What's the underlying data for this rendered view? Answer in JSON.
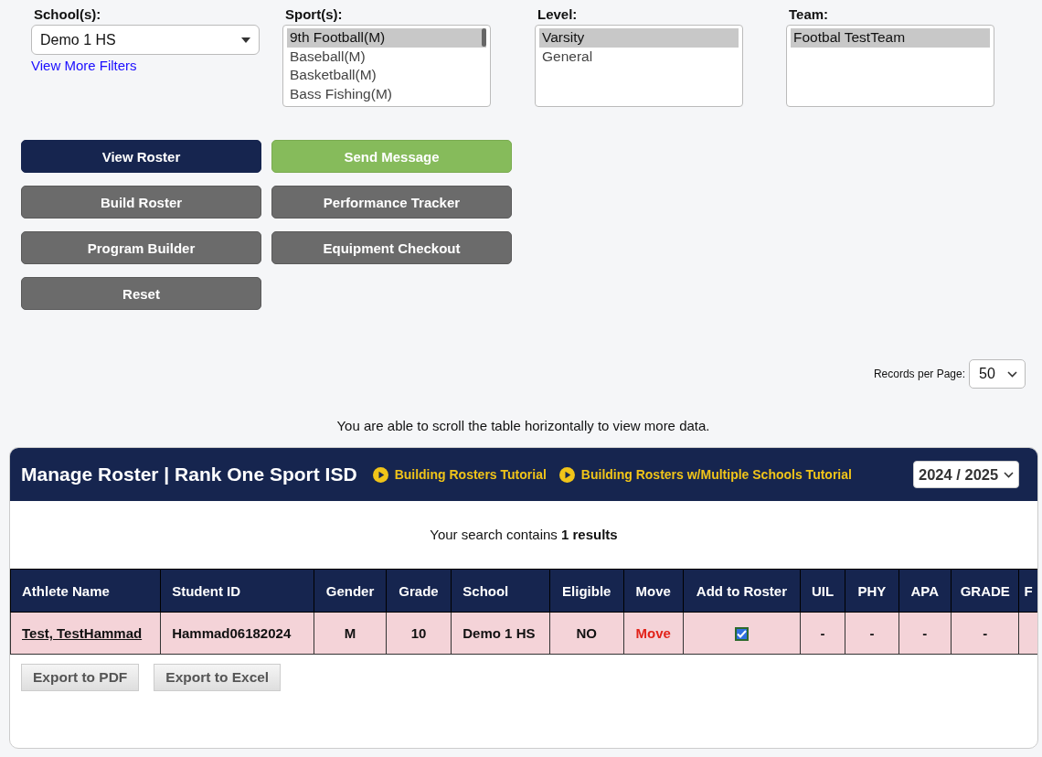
{
  "filters": [
    {
      "label": "School(s):",
      "kind": "dropdown",
      "value": "Demo 1 HS",
      "link": "View More Filters"
    },
    {
      "label": "Sport(s):",
      "kind": "listbox",
      "options": [
        {
          "text": "9th Football(M)",
          "selected": true
        },
        {
          "text": "Baseball(M)",
          "selected": false
        },
        {
          "text": "Basketball(M)",
          "selected": false
        },
        {
          "text": "Bass Fishing(M)",
          "selected": false
        }
      ]
    },
    {
      "label": "Level:",
      "kind": "listbox",
      "options": [
        {
          "text": "Varsity",
          "selected": true
        },
        {
          "text": "General",
          "selected": false
        }
      ]
    },
    {
      "label": "Team:",
      "kind": "listbox",
      "options": [
        {
          "text": "Footbal TestTeam",
          "selected": true
        }
      ]
    }
  ],
  "buttons": [
    [
      {
        "label": "View Roster",
        "kind": "primary"
      },
      {
        "label": "Send Message",
        "kind": "success"
      }
    ],
    [
      {
        "label": "Build Roster",
        "kind": "default"
      },
      {
        "label": "Performance Tracker",
        "kind": "default"
      }
    ],
    [
      {
        "label": "Program Builder",
        "kind": "default"
      },
      {
        "label": "Equipment Checkout",
        "kind": "default"
      }
    ],
    [
      {
        "label": "Reset",
        "kind": "default"
      }
    ]
  ],
  "records_per_page": {
    "label": "Records per Page:",
    "value": "50"
  },
  "scroll_hint": "You are able to scroll the table horizontally to view more data.",
  "panel": {
    "title": "Manage Roster | Rank One Sport ISD",
    "tutorials": [
      "Building Rosters Tutorial",
      "Building Rosters w/Multiple Schools Tutorial"
    ],
    "year": "2024 / 2025",
    "summary": "Your search contains **1 results**",
    "table": {
      "columns": [
        "Athlete Name",
        "Student ID",
        "Gender",
        "Grade",
        "School",
        "Eligible",
        "Move",
        "Add to Roster",
        "UIL",
        "PHY",
        "APA",
        "GRADE",
        "F"
      ],
      "rows": [
        {
          "athlete": "Test, TestHammad",
          "student_id": "Hammad06182024",
          "gender": "M",
          "grade": "10",
          "school": "Demo 1 HS",
          "eligible": "NO",
          "move": "Move",
          "add_to_roster": true,
          "uil": "-",
          "phy": "-",
          "apa": "-",
          "grade_status": "-"
        }
      ]
    },
    "exports": [
      "Export to PDF",
      "Export to Excel"
    ]
  }
}
